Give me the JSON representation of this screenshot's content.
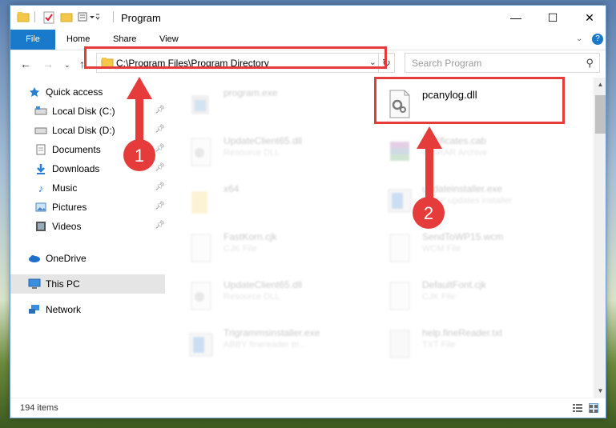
{
  "window": {
    "title": "Program",
    "controls": {
      "minimize": "—",
      "maximize": "☐",
      "close": "✕"
    }
  },
  "ribbon": {
    "tabs": [
      "File",
      "Home",
      "Share",
      "View"
    ]
  },
  "navigation": {
    "address": "C:\\Program Files\\Program Directory",
    "search_placeholder": "Search Program"
  },
  "sidebar": {
    "items": [
      {
        "label": "Quick access",
        "icon": "star-icon"
      },
      {
        "label": "Local Disk (C:)",
        "icon": "drive-icon",
        "pinned": true
      },
      {
        "label": "Local Disk (D:)",
        "icon": "drive-icon",
        "pinned": true
      },
      {
        "label": "Documents",
        "icon": "documents-icon",
        "pinned": true
      },
      {
        "label": "Downloads",
        "icon": "download-icon",
        "pinned": true
      },
      {
        "label": "Music",
        "icon": "music-icon",
        "pinned": true
      },
      {
        "label": "Pictures",
        "icon": "pictures-icon",
        "pinned": true
      },
      {
        "label": "Videos",
        "icon": "videos-icon",
        "pinned": true
      },
      {
        "label": "OneDrive",
        "icon": "cloud-icon"
      },
      {
        "label": "This PC",
        "icon": "computer-icon",
        "selected": true
      },
      {
        "label": "Network",
        "icon": "network-icon"
      }
    ]
  },
  "files": {
    "left": [
      {
        "name": "program.exe",
        "desc": ""
      },
      {
        "name": "UpdateClient65.dll",
        "desc": "Resource DLL"
      },
      {
        "name": "x64",
        "desc": ""
      },
      {
        "name": "FastKorn.cjk",
        "desc": "CJK File"
      },
      {
        "name": "UpdateClient65.dll",
        "desc": "Resource DLL"
      },
      {
        "name": "Trigrammsinstaller.exe",
        "desc": "ABBY finereader tri..."
      }
    ],
    "right": [
      {
        "name": "pcanylog.dll",
        "desc": ""
      },
      {
        "name": "certificates.cab",
        "desc": "WinRAR Archive"
      },
      {
        "name": "updateinstaller.exe",
        "desc": "ABBY updates installer"
      },
      {
        "name": "SendToWP15.wcm",
        "desc": "WCM File"
      },
      {
        "name": "DefaultFont.cjk",
        "desc": "CJK File"
      },
      {
        "name": "help.fineReader.txt",
        "desc": "TXT File"
      }
    ]
  },
  "status": {
    "item_count": "194 items"
  },
  "annotations": {
    "step1": "1",
    "step2": "2",
    "color": "#e53b3b"
  }
}
